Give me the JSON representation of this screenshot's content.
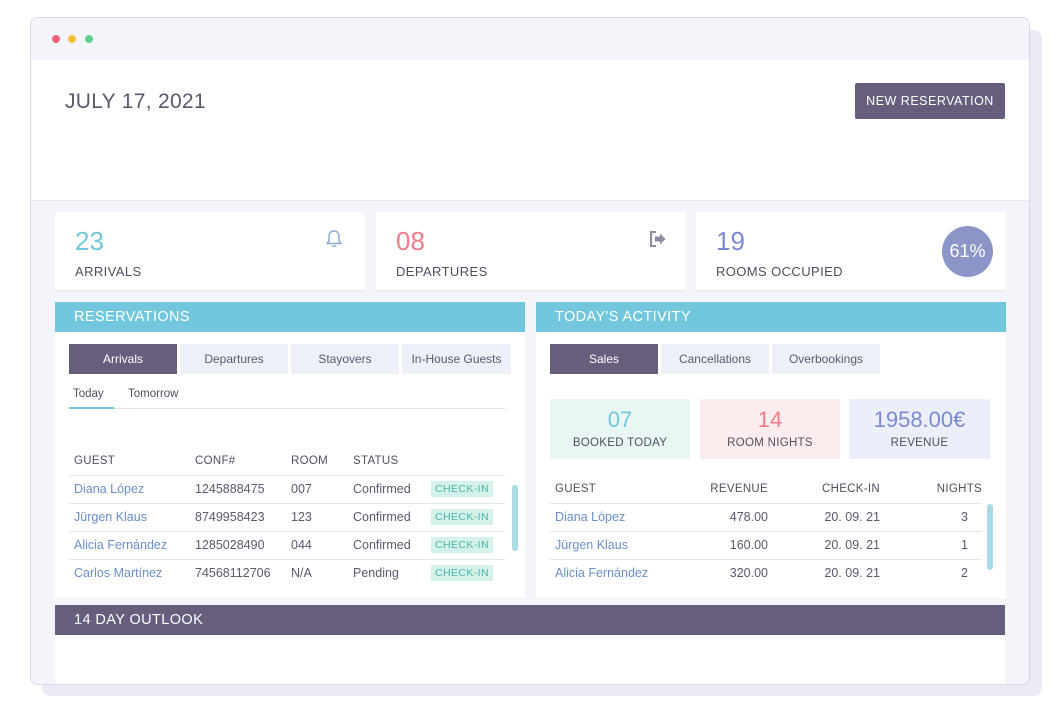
{
  "header": {
    "date": "JULY 17, 2021",
    "new_button": "NEW RESERVATION"
  },
  "cards": [
    {
      "number": "08",
      "label": "DEPARTURES",
      "icon": "exit-icon",
      "color": "#f07c86"
    },
    {
      "number": "23",
      "label": "ARRIVALS",
      "icon": "bell-icon",
      "color": "#72c7dc"
    },
    {
      "number": "19",
      "label": "ROOMS OCCUPIED",
      "percent": "61%",
      "color": "#7b89d6"
    }
  ],
  "reservations": {
    "title": "RESERVATIONS",
    "tabs": [
      "Arrivals",
      "Departures",
      "Stayovers",
      "In-House Guests"
    ],
    "subtabs": [
      "Today",
      "Tomorrow"
    ],
    "columns": [
      "GUEST",
      "CONF#",
      "ROOM",
      "STATUS"
    ],
    "rows": [
      {
        "guest": "Diana López",
        "conf": "1245888475",
        "room": "007",
        "status": "Confirmed",
        "action": "CHECK-IN"
      },
      {
        "guest": "Jürgen Klaus",
        "conf": "8749958423",
        "room": "123",
        "status": "Confirmed",
        "action": "CHECK-IN"
      },
      {
        "guest": "Alicia Fernández",
        "conf": "1285028490",
        "room": "044",
        "status": "Confirmed",
        "action": "CHECK-IN"
      },
      {
        "guest": "Carlos Martínez",
        "conf": "74568112706",
        "room": "N/A",
        "status": "Pending",
        "action": "CHECK-IN"
      }
    ]
  },
  "activity": {
    "title": "TODAY'S ACTIVITY",
    "tabs": [
      "Sales",
      "Cancellations",
      "Overbookings"
    ],
    "stats": [
      {
        "value": "07",
        "label": "BOOKED TODAY",
        "color": "#72c7dc",
        "bg": "#e8f6f4"
      },
      {
        "value": "14",
        "label": "ROOM NIGHTS",
        "color": "#f07c86",
        "bg": "#fdeced"
      },
      {
        "value": "1958.00€",
        "label": "REVENUE",
        "color": "#7b89d6",
        "bg": "#eceefa"
      }
    ],
    "columns": [
      "GUEST",
      "REVENUE",
      "CHECK-IN",
      "NIGHTS"
    ],
    "rows": [
      {
        "guest": "Diana López",
        "revenue": "478.00",
        "checkin": "20. 09. 21",
        "nights": "3"
      },
      {
        "guest": "Jürgen Klaus",
        "revenue": "160.00",
        "checkin": "20. 09. 21",
        "nights": "1"
      },
      {
        "guest": "Alicia Fernández",
        "revenue": "320.00",
        "checkin": "20. 09. 21",
        "nights": "2"
      }
    ]
  },
  "outlook": {
    "title": "14 DAY OUTLOOK"
  }
}
